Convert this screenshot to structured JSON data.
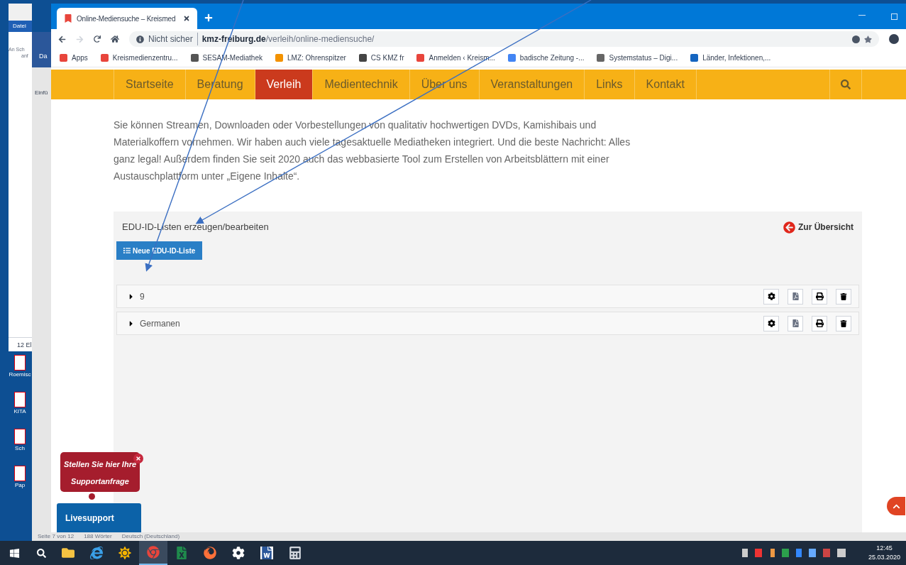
{
  "desktop": {
    "explorer": {
      "menu": "Datei",
      "pin_label": "An Sch",
      "pin_label_2": "anf",
      "status": "12 El"
    },
    "word": {
      "tab": "Da",
      "group": "Einfü",
      "status": [
        "Seite 7 von 12",
        "188 Wörter",
        "Deutsch (Deutschland)"
      ]
    },
    "icons": [
      {
        "label": "Roemisc"
      },
      {
        "label": "KITA"
      },
      {
        "label": "Sch"
      },
      {
        "label": "Pap"
      }
    ]
  },
  "browser": {
    "tab_title": "Online-Mediensuche – Kreismed",
    "security": "Nicht sicher",
    "url": "**kmz-freiburg.de**/verleih/online-mediensuche/",
    "bookmarks": [
      {
        "label": "Apps",
        "color": "#e8453c"
      },
      {
        "label": "Kreismedienzentru...",
        "color": "#e8453c"
      },
      {
        "label": "SESAM-Mediathek",
        "color": "#555555"
      },
      {
        "label": "LMZ: Ohrenspitzer",
        "color": "#f39200"
      },
      {
        "label": "CS KMZ fr",
        "color": "#444444"
      },
      {
        "label": "Anmelden ‹ Kreism...",
        "color": "#e8453c"
      },
      {
        "label": "badische Zeitung -...",
        "color": "#4285f4"
      },
      {
        "label": "Systemstatus – Digi...",
        "color": "#666666"
      },
      {
        "label": "Länder, Infektionen,...",
        "color": "#1565c0"
      }
    ]
  },
  "nav": [
    {
      "label": "Startseite",
      "selected": false
    },
    {
      "label": "Beratung",
      "selected": false
    },
    {
      "label": "Verleih",
      "selected": true
    },
    {
      "label": "Medientechnik",
      "selected": false
    },
    {
      "label": "Über uns",
      "selected": false
    },
    {
      "label": "Veranstaltungen",
      "selected": false
    },
    {
      "label": "Links",
      "selected": false
    },
    {
      "label": "Kontakt",
      "selected": false
    }
  ],
  "intro": "Sie können Streamen, Downloaden oder Vorbestellungen von qualitativ hochwertigen DVDs, Kamishibais und Materialkoffern vornehmen. Wir haben auch viele tagesaktuelle Mediatheken integriert. Und die beste Nachricht: Alles ganz legal! Außerdem finden Sie seit 2020 auch das webbasierte Tool zum Erstellen von Arbeitsblättern mit einer Austauschplattform unter „Eigene Inhalte“.",
  "panel": {
    "title": "EDU-ID-Listen erzeugen/bearbeiten",
    "back_link": "Zur Übersicht",
    "new_button": "Neue EDU-ID-Liste",
    "lists": [
      {
        "name": "9",
        "expanded": false
      },
      {
        "name": "Germanen",
        "expanded": false
      }
    ]
  },
  "support": {
    "bubble": "Stellen Sie hier Ihre Supportanfrage",
    "button": "Livesupport"
  },
  "taskbar": {
    "apps": [
      {
        "kind": "explorer",
        "selected": false
      },
      {
        "kind": "ie",
        "selected": false
      },
      {
        "kind": "sun",
        "selected": false
      },
      {
        "kind": "chrome",
        "selected": true
      },
      {
        "kind": "excel",
        "selected": false
      },
      {
        "kind": "firefox",
        "selected": false
      },
      {
        "kind": "gear",
        "selected": false
      },
      {
        "kind": "word",
        "selected": false
      },
      {
        "kind": "calculator",
        "selected": false
      }
    ],
    "time": "12:45",
    "date": "25.03.2020"
  }
}
